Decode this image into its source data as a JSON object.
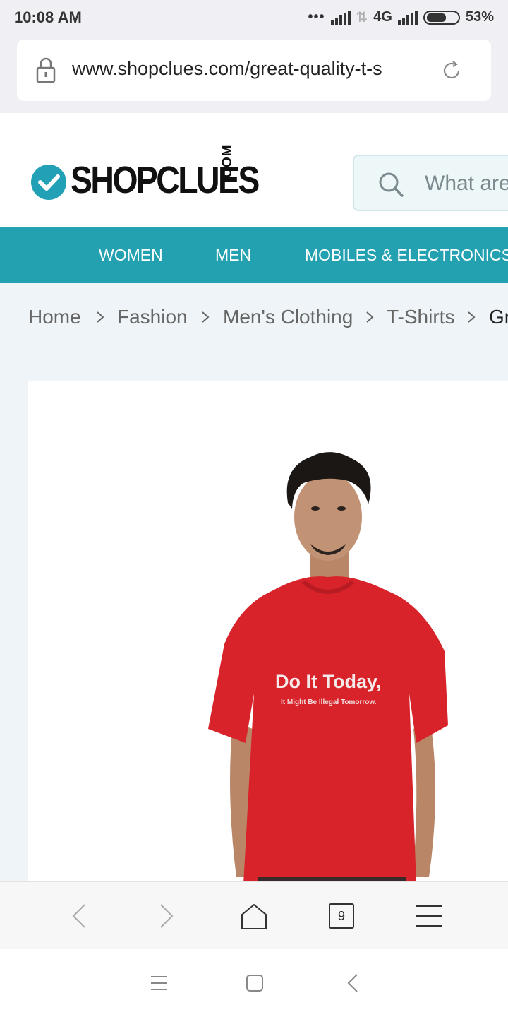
{
  "status_bar": {
    "time": "10:08 AM",
    "network": "4G",
    "battery": "53%"
  },
  "address_bar": {
    "url": "www.shopclues.com/great-quality-t-s"
  },
  "header": {
    "logo_main": "SHOPCLUES",
    "logo_suffix": ".COM",
    "search_placeholder": "What are"
  },
  "nav": {
    "items": [
      "WOMEN",
      "MEN",
      "MOBILES & ELECTRONICS"
    ]
  },
  "breadcrumb": {
    "items": [
      "Home",
      "Fashion",
      "Men's Clothing",
      "T-Shirts",
      "Gr"
    ]
  },
  "product": {
    "tshirt_print_main": "Do It Today,",
    "tshirt_print_sub": "It Might Be Illegal Tomorrow."
  },
  "browser_toolbar": {
    "tab_count": "9"
  },
  "colors": {
    "brand_teal": "#23a1b1",
    "shirt_red": "#d8232a"
  }
}
